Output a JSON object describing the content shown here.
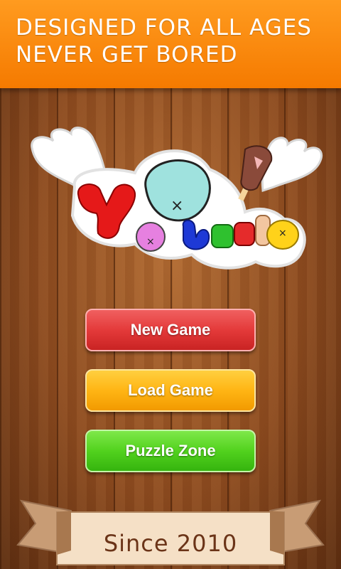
{
  "header": {
    "line1": "DESIGNED FOR ALL AGES",
    "line2": "NEVER GET BORED"
  },
  "menu": {
    "new_game": "New Game",
    "load_game": "Load Game",
    "puzzle_zone": "Puzzle Zone"
  },
  "footer": {
    "since": "Since 2010"
  },
  "colors": {
    "banner": "#f57a00",
    "new_game": "#e43a3a",
    "load_game": "#ffb514",
    "puzzle_zone": "#52d21e"
  }
}
